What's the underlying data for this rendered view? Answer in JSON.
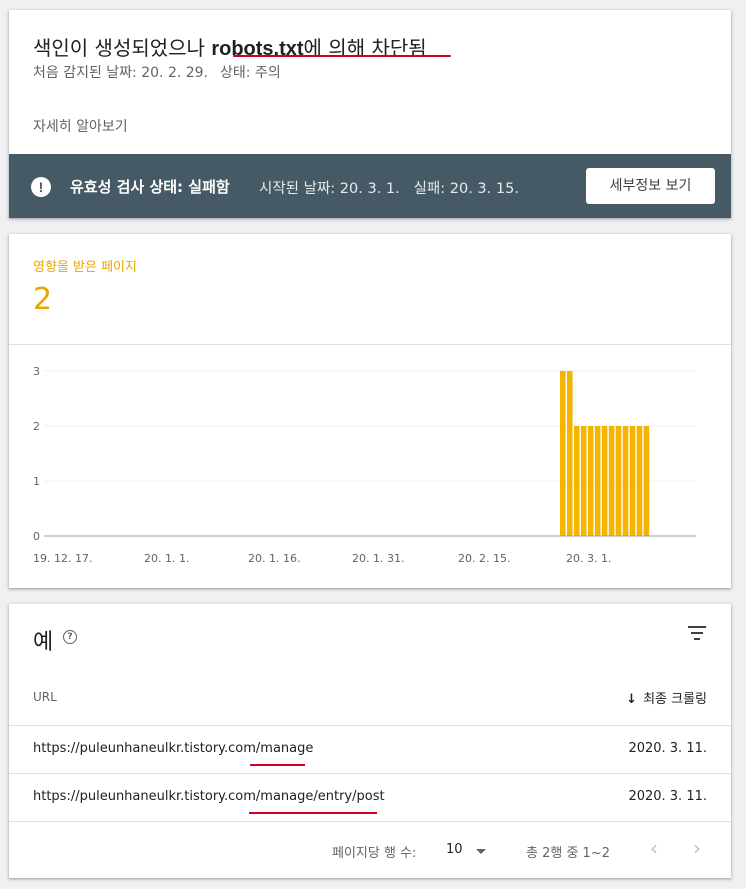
{
  "issue": {
    "title_prefix": "색인이 생성되었으나 ",
    "title_bold": "robots.txt",
    "title_suffix": "에 의해 차단됨",
    "first_detected": "처음 감지된 날짜: 20. 2. 29.",
    "status": "상태: 주의",
    "learn_more": "자세히 알아보기"
  },
  "validation": {
    "status_label": "유효성 검사 상태: 실패함",
    "started": "시작된 날짜: 20. 3. 1.",
    "failed": "실패: 20. 3. 15.",
    "details_button": "세부정보 보기",
    "alert_icon": "!",
    "bar_color": "#455a64"
  },
  "affected": {
    "label": "영향을 받은 페이지",
    "value": "2",
    "accent": "#e8a600"
  },
  "chart_data": {
    "type": "bar",
    "color": "#f4b400",
    "y_ticks": [
      "0",
      "1",
      "2",
      "3"
    ],
    "ylim": [
      0,
      3
    ],
    "x_ticks": [
      "19. 12. 17.",
      "20. 1. 1.",
      "20. 1. 16.",
      "20. 1. 31.",
      "20. 2. 15.",
      "20. 3. 1."
    ],
    "bars": [
      {
        "date": "2020-02-29",
        "value": 3
      },
      {
        "date": "2020-03-01",
        "value": 3
      },
      {
        "date": "2020-03-02",
        "value": 2
      },
      {
        "date": "2020-03-03",
        "value": 2
      },
      {
        "date": "2020-03-04",
        "value": 2
      },
      {
        "date": "2020-03-05",
        "value": 2
      },
      {
        "date": "2020-03-06",
        "value": 2
      },
      {
        "date": "2020-03-07",
        "value": 2
      },
      {
        "date": "2020-03-08",
        "value": 2
      },
      {
        "date": "2020-03-09",
        "value": 2
      },
      {
        "date": "2020-03-10",
        "value": 2
      },
      {
        "date": "2020-03-11",
        "value": 2
      },
      {
        "date": "2020-03-12",
        "value": 2
      }
    ],
    "grid": true
  },
  "examples": {
    "title": "예",
    "help_icon": "?",
    "col_url": "URL",
    "col_last_crawl": "최종 크롤링",
    "sort_icon": "↓",
    "rows": [
      {
        "url": "https://puleunhaneulkr.tistory.com/manage",
        "date": "2020. 3. 11."
      },
      {
        "url": "https://puleunhaneulkr.tistory.com/manage/entry/post",
        "date": "2020. 3. 11."
      }
    ],
    "pagination": {
      "rows_per_page_label": "페이지당 행 수:",
      "rows_per_page": "10",
      "range": "총 2행 중 1~2",
      "prev_icon": "‹",
      "next_icon": "›"
    }
  }
}
